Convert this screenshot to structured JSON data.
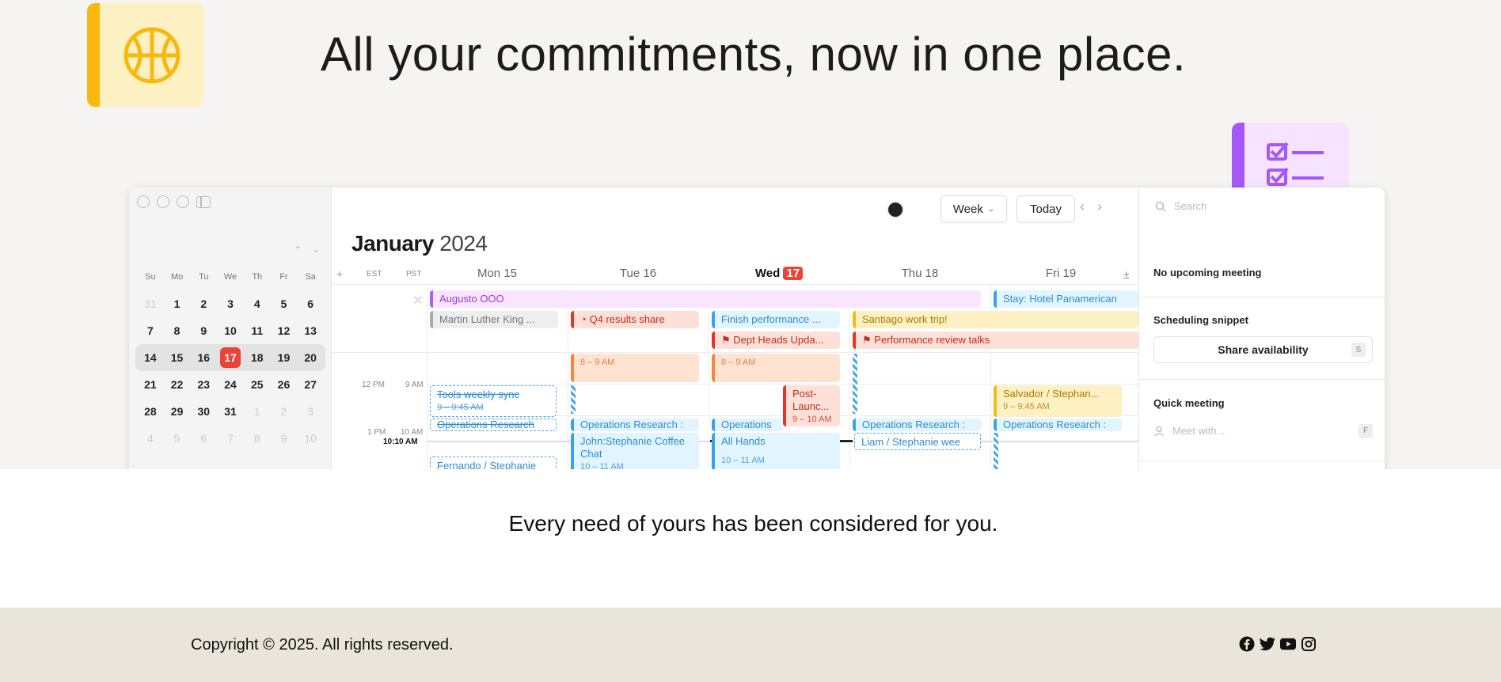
{
  "hero": {
    "headline": "All your commitments, now in one place."
  },
  "app": {
    "mini_calendar": {
      "weekday_headers": [
        "Su",
        "Mo",
        "Tu",
        "We",
        "Th",
        "Fr",
        "Sa"
      ],
      "weeks": [
        [
          "31",
          "1",
          "2",
          "3",
          "4",
          "5",
          "6"
        ],
        [
          "7",
          "8",
          "9",
          "10",
          "11",
          "12",
          "13"
        ],
        [
          "14",
          "15",
          "16",
          "17",
          "18",
          "19",
          "20"
        ],
        [
          "21",
          "22",
          "23",
          "24",
          "25",
          "26",
          "27"
        ],
        [
          "28",
          "29",
          "30",
          "31",
          "1",
          "2",
          "3"
        ],
        [
          "4",
          "5",
          "6",
          "7",
          "8",
          "9",
          "10"
        ]
      ],
      "selected_day": "17"
    },
    "toolbar": {
      "view_label": "Week",
      "today_label": "Today"
    },
    "month_bold": "January",
    "year": "2024",
    "timezones": [
      "EST",
      "PST"
    ],
    "days": [
      "Mon 15",
      "Tue 16",
      "Wed",
      "Thu 18",
      "Fri 19"
    ],
    "wed_date": "17",
    "times": {
      "pst_9": "9 AM",
      "est_12": "12 PM",
      "est_1": "1 PM",
      "pst_10": "10 AM",
      "now": "10:10 AM"
    },
    "events": {
      "augusto": "Augusto OOO",
      "stay": "Stay: Hotel Panamerican",
      "mlk": "Martin Luther King ...",
      "q4": "Q4 results share",
      "finish": "Finish performance ...",
      "santiago": "Santiago work trip!",
      "dept": "Dept Heads Upda...",
      "perf": "Performance review talks",
      "tue_8": "8 – 9 AM",
      "wed_8": "8 – 9 AM",
      "tools": "Tools weekly sync",
      "tools_time": "9 – 9:45 AM",
      "post": "Post-Launc...",
      "post_time": "9 – 10 AM",
      "salvador": "Salvador / Stephan...",
      "salvador_time": "9 – 9:45 AM",
      "ops_mon": "Operations Research",
      "ops_tue": "Operations Research :",
      "ops_wed": "Operations",
      "ops_thu": "Operations Research :",
      "ops_fri": "Operations Research :",
      "john": "John:Stephanie Coffee Chat",
      "john_time": "10 – 11 AM",
      "allhands": "All Hands",
      "allhands_time": "10 – 11 AM",
      "liam": "Liam / Stephanie wee",
      "fernando": "Fernando / Stephanie"
    },
    "right_panel": {
      "search_placeholder": "Search",
      "no_meeting": "No upcoming meeting",
      "snippet_title": "Scheduling snippet",
      "share_label": "Share availability",
      "share_key": "S",
      "quick_title": "Quick meeting",
      "meet_placeholder": "Meet with...",
      "meet_key": "F"
    }
  },
  "tagline": "Every need of yours has been considered for you.",
  "footer": {
    "copyright": "Copyright © 2025. All rights reserved.",
    "social": [
      "facebook-icon",
      "twitter-icon",
      "youtube-icon",
      "instagram-icon"
    ]
  },
  "colors": {
    "accent_yellow": "#f8b80d",
    "accent_purple": "#a458f5",
    "today_red": "#ea4337",
    "footer_bg": "#e9e5db"
  }
}
